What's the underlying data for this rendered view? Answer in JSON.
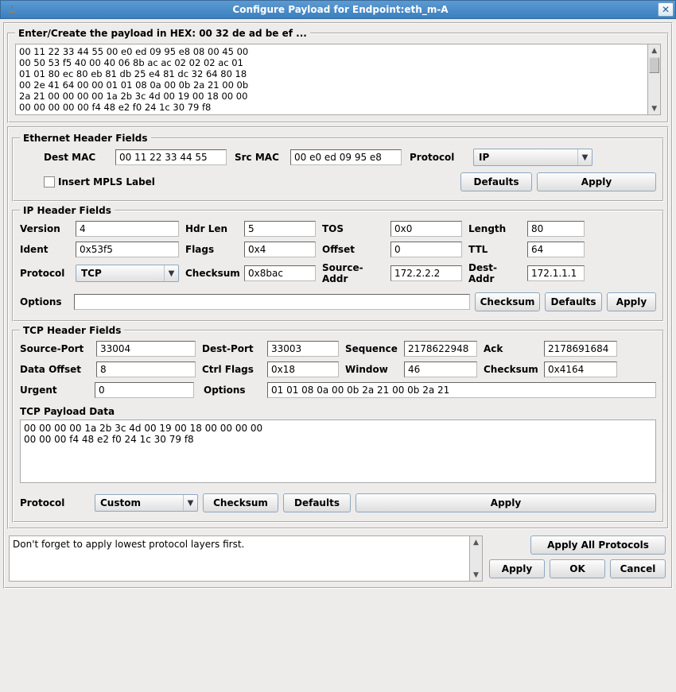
{
  "window": {
    "title": "Configure Payload for Endpoint:eth_m-A",
    "close_icon": "✕"
  },
  "hex": {
    "legend": "Enter/Create the payload in HEX:  00 32 de ad be ef ...",
    "content": "00 11 22 33 44 55 00 e0 ed 09 95 e8 08 00 45 00\n00 50 53 f5 40 00 40 06 8b ac ac 02 02 02 ac 01\n01 01 80 ec 80 eb 81 db 25 e4 81 dc 32 64 80 18\n00 2e 41 64 00 00 01 01 08 0a 00 0b 2a 21 00 0b\n2a 21 00 00 00 00 1a 2b 3c 4d 00 19 00 18 00 00\n00 00 00 00 00 f4 48 e2 f0 24 1c 30 79 f8"
  },
  "eth": {
    "legend": "Ethernet Header Fields",
    "labels": {
      "dest": "Dest MAC",
      "src": "Src MAC",
      "proto": "Protocol",
      "mpls": "Insert MPLS Label"
    },
    "dest_mac": "00 11 22 33 44 55",
    "src_mac": "00 e0 ed 09 95 e8",
    "protocol": "IP",
    "buttons": {
      "defaults": "Defaults",
      "apply": "Apply"
    }
  },
  "ip": {
    "legend": "IP Header Fields",
    "labels": {
      "version": "Version",
      "hdrlen": "Hdr Len",
      "tos": "TOS",
      "length": "Length",
      "ident": "Ident",
      "flags": "Flags",
      "offset": "Offset",
      "ttl": "TTL",
      "protocol": "Protocol",
      "checksum_lbl": "Checksum",
      "src": "Source-Addr",
      "dst": "Dest-Addr",
      "options": "Options"
    },
    "version": "4",
    "hdrlen": "5",
    "tos": "0x0",
    "length": "80",
    "ident": "0x53f5",
    "flags": "0x4",
    "offset": "0",
    "ttl": "64",
    "protocol": "TCP",
    "checksum": "0x8bac",
    "src": "172.2.2.2",
    "dst": "172.1.1.1",
    "options": "",
    "buttons": {
      "checksum": "Checksum",
      "defaults": "Defaults",
      "apply": "Apply"
    }
  },
  "tcp": {
    "legend": "TCP Header Fields",
    "labels": {
      "sport": "Source-Port",
      "dport": "Dest-Port",
      "seq": "Sequence",
      "ack": "Ack",
      "dataoff": "Data Offset",
      "ctrl": "Ctrl Flags",
      "window": "Window",
      "cksum": "Checksum",
      "urgent": "Urgent",
      "options": "Options",
      "payload": "TCP Payload Data",
      "proto": "Protocol"
    },
    "sport": "33004",
    "dport": "33003",
    "seq": "2178622948",
    "ack": "2178691684",
    "dataoff": "8",
    "ctrl": "0x18",
    "window": "46",
    "cksum": "0x4164",
    "urgent": "0",
    "options": "01 01 08 0a 00 0b 2a 21 00 0b 2a 21",
    "payload": "00 00 00 00 1a 2b 3c 4d 00 19 00 18 00 00 00 00\n00 00 00 f4 48 e2 f0 24 1c 30 79 f8",
    "protocol": "Custom",
    "buttons": {
      "checksum": "Checksum",
      "defaults": "Defaults",
      "apply": "Apply"
    }
  },
  "footer": {
    "message": "Don't forget to apply lowest protocol layers first.",
    "buttons": {
      "apply_all": "Apply All Protocols",
      "apply": "Apply",
      "ok": "OK",
      "cancel": "Cancel"
    }
  }
}
